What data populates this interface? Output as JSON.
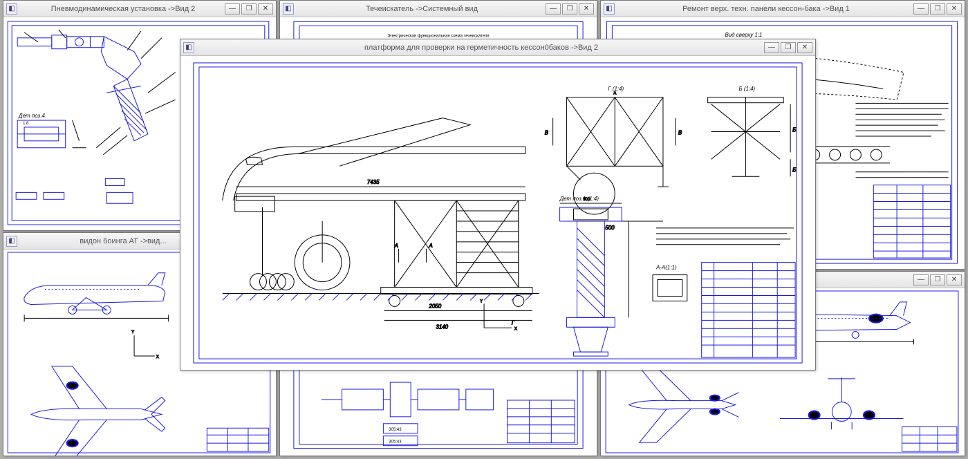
{
  "windows": {
    "pneumo": {
      "title": "Пневмодинамическая установка ->Вид 2"
    },
    "leak": {
      "title": "Течеискатель ->Системный вид",
      "note": "Электрическая функциональная схема течеискателя"
    },
    "repair": {
      "title": "Ремонт верх. техн. панели кессон-бака ->Вид 1",
      "note": "Вид сверху 1:1"
    },
    "boeing": {
      "title": "видон боинга АТ ->вид..."
    },
    "yak": {
      "title": ""
    },
    "platform": {
      "title": "платформа для проверки на герметичность кессон0баков ->Вид 2",
      "labels": {
        "g": "Г (1:4)",
        "b": "Б (1:4)",
        "det": "Дет поз.1 (1:4)",
        "aa": "А-А(1:1)",
        "dim1": "7435",
        "dim2": "2050",
        "dim3": "3140",
        "dim4": "500",
        "dim5": "500",
        "axA1": "А",
        "axA2": "А",
        "axB1": "В",
        "axB2": "В",
        "axG": "Г",
        "axBb1": "Б",
        "axBb2": "Б"
      }
    }
  },
  "buttons": {
    "min": "—",
    "max": "❐",
    "close": "✕"
  }
}
